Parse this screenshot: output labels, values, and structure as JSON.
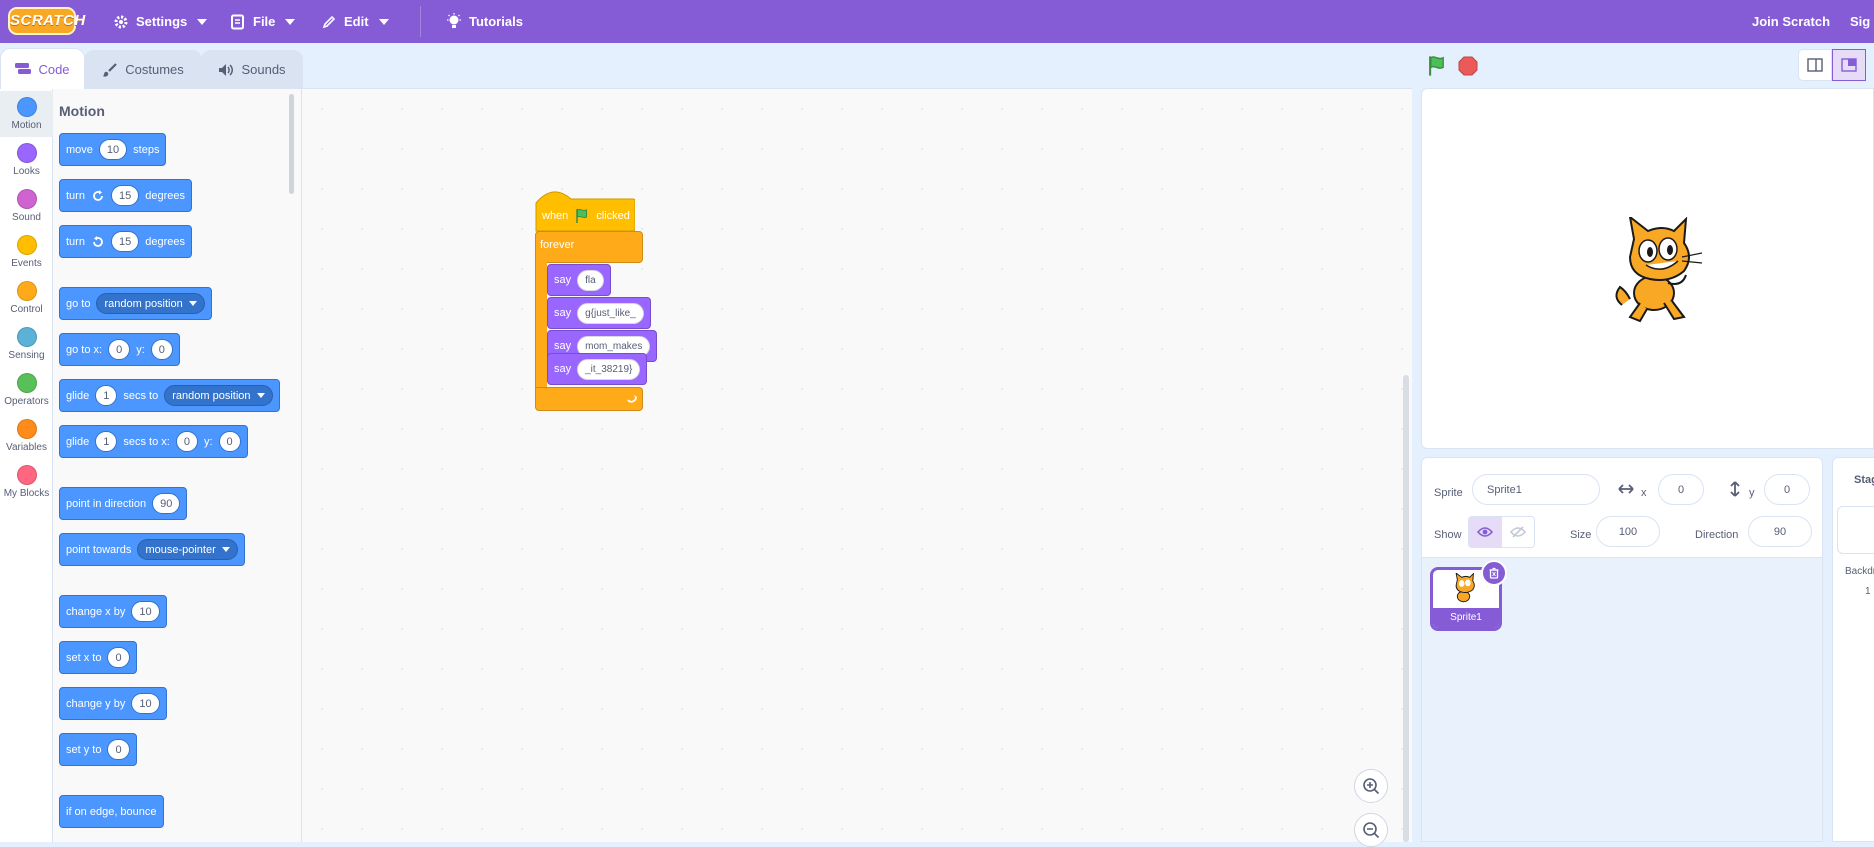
{
  "menubar": {
    "logo": "SCRATCH",
    "settings": "Settings",
    "file": "File",
    "edit": "Edit",
    "tutorials": "Tutorials",
    "join": "Join Scratch",
    "signin": "Sig"
  },
  "tabs": {
    "code": "Code",
    "costumes": "Costumes",
    "sounds": "Sounds"
  },
  "categories": [
    {
      "label": "Motion",
      "color": "#4c97ff"
    },
    {
      "label": "Looks",
      "color": "#9966ff"
    },
    {
      "label": "Sound",
      "color": "#cf63cf"
    },
    {
      "label": "Events",
      "color": "#ffbf00"
    },
    {
      "label": "Control",
      "color": "#ffab19"
    },
    {
      "label": "Sensing",
      "color": "#5cb1d6"
    },
    {
      "label": "Operators",
      "color": "#59c059"
    },
    {
      "label": "Variables",
      "color": "#ff8c1a"
    },
    {
      "label": "My Blocks",
      "color": "#ff6680"
    }
  ],
  "palette": {
    "title": "Motion",
    "move": {
      "a": "move",
      "v": "10",
      "b": "steps"
    },
    "turn_right": {
      "a": "turn",
      "v": "15",
      "b": "degrees"
    },
    "turn_left": {
      "a": "turn",
      "v": "15",
      "b": "degrees"
    },
    "goto": {
      "a": "go to",
      "dd": "random position"
    },
    "goto_xy": {
      "a": "go to x:",
      "x": "0",
      "b": "y:",
      "y": "0"
    },
    "glide_to": {
      "a": "glide",
      "v": "1",
      "b": "secs to",
      "dd": "random position"
    },
    "glide_xy": {
      "a": "glide",
      "v": "1",
      "b": "secs to x:",
      "x": "0",
      "c": "y:",
      "y": "0"
    },
    "point_dir": {
      "a": "point in direction",
      "v": "90"
    },
    "point_towards": {
      "a": "point towards",
      "dd": "mouse-pointer"
    },
    "change_x": {
      "a": "change x by",
      "v": "10"
    },
    "set_x": {
      "a": "set x to",
      "v": "0"
    },
    "change_y": {
      "a": "change y by",
      "v": "10"
    },
    "set_y": {
      "a": "set y to",
      "v": "0"
    },
    "bounce": {
      "a": "if on edge, bounce"
    }
  },
  "script": {
    "hat": {
      "a": "when",
      "b": "clicked"
    },
    "forever": "forever",
    "says": [
      {
        "label": "say",
        "value": "fla"
      },
      {
        "label": "say",
        "value": "g{just_like_"
      },
      {
        "label": "say",
        "value": "mom_makes"
      },
      {
        "label": "say",
        "value": "_it_38219}"
      }
    ]
  },
  "sprite_info": {
    "sprite_label": "Sprite",
    "sprite_name": "Sprite1",
    "x_label": "x",
    "x_value": "0",
    "y_label": "y",
    "y_value": "0",
    "show_label": "Show",
    "size_label": "Size",
    "size_value": "100",
    "direction_label": "Direction",
    "direction_value": "90"
  },
  "sprites": [
    {
      "name": "Sprite1"
    }
  ],
  "stage_pane": {
    "title": "Stag",
    "backdrops_label": "Backdr",
    "backdrops_count": "1"
  },
  "colors": {
    "menubar": "#855cd6",
    "motion": "#4c97ff",
    "events": "#ffbf00",
    "control": "#ffab19",
    "looks": "#9966ff"
  }
}
